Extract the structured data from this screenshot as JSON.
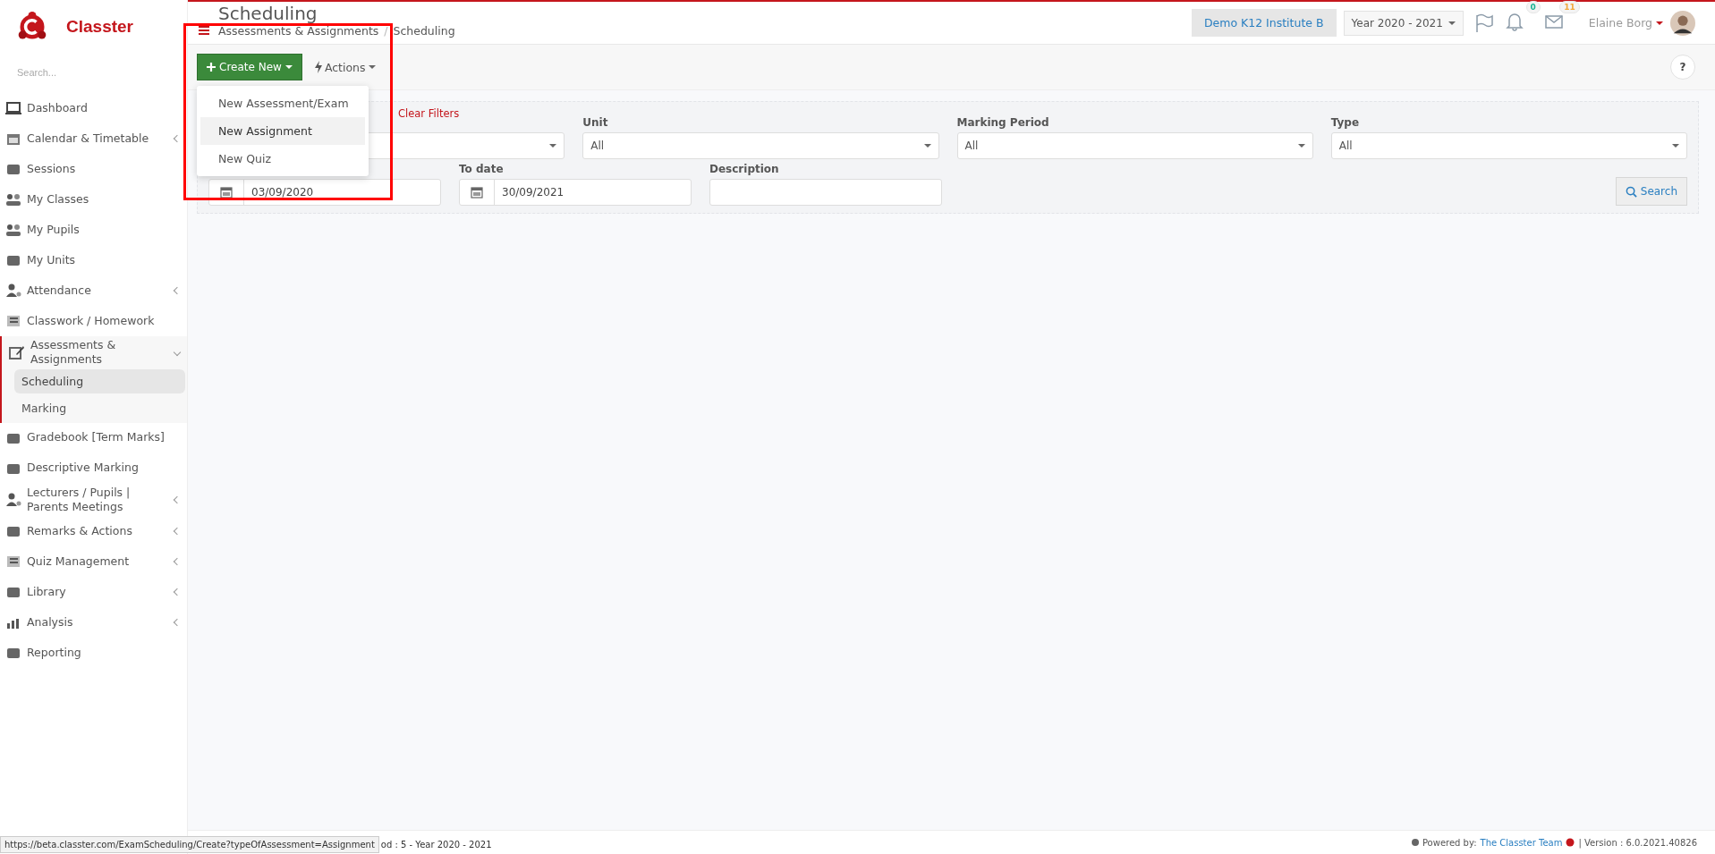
{
  "app": {
    "name": "Classter"
  },
  "sidebar": {
    "search": {
      "placeholder": "Search..."
    },
    "items": [
      {
        "label": "Dashboard",
        "has_submenu": false,
        "selected": false
      },
      {
        "label": "Calendar & Timetable",
        "has_submenu": true,
        "expanded": false,
        "selected": false
      },
      {
        "label": "Sessions",
        "has_submenu": false,
        "selected": false
      },
      {
        "label": "My Classes",
        "has_submenu": false,
        "selected": false
      },
      {
        "label": "My Pupils",
        "has_submenu": false,
        "selected": false
      },
      {
        "label": "My Units",
        "has_submenu": false,
        "selected": false
      },
      {
        "label": "Attendance",
        "has_submenu": true,
        "expanded": false,
        "selected": false
      },
      {
        "label": "Classwork / Homework",
        "has_submenu": false,
        "selected": false
      },
      {
        "label": "Assessments & Assignments",
        "has_submenu": true,
        "expanded": true,
        "selected": true,
        "children": [
          {
            "label": "Scheduling",
            "selected": true
          },
          {
            "label": "Marking",
            "selected": false
          }
        ]
      },
      {
        "label": "Gradebook [Term Marks]",
        "has_submenu": false,
        "selected": false
      },
      {
        "label": "Descriptive Marking",
        "has_submenu": false,
        "selected": false
      },
      {
        "label": "Lecturers / Pupils | Parents Meetings",
        "has_submenu": true,
        "expanded": false,
        "selected": false
      },
      {
        "label": "Remarks & Actions",
        "has_submenu": true,
        "expanded": false,
        "selected": false
      },
      {
        "label": "Quiz Management",
        "has_submenu": true,
        "expanded": false,
        "selected": false
      },
      {
        "label": "Library",
        "has_submenu": true,
        "expanded": false,
        "selected": false
      },
      {
        "label": "Analysis",
        "has_submenu": true,
        "expanded": false,
        "selected": false
      },
      {
        "label": "Reporting",
        "has_submenu": false,
        "selected": false
      }
    ]
  },
  "header": {
    "title": "Scheduling",
    "breadcrumb": [
      "Assessments & Assignments",
      "Scheduling"
    ],
    "breadcrumb_separator": "/",
    "institute": "Demo K12 Institute B",
    "year": "Year 2020 - 2021",
    "notifications_badge": "0",
    "messages_badge": "11",
    "user": "Elaine Borg"
  },
  "toolbar": {
    "create_button": "Create New",
    "actions_button": "Actions",
    "help": "?",
    "create_menu": [
      {
        "label": "New Assessment/Exam",
        "selected": false
      },
      {
        "label": "New Assignment",
        "selected": true
      },
      {
        "label": "New Quiz",
        "selected": false
      }
    ]
  },
  "filters": {
    "clear_link": "Clear Filters",
    "row_1": [
      {
        "kind": "select"
      },
      {
        "kind": "select",
        "label": "Unit",
        "value": "All"
      },
      {
        "kind": "select",
        "label": "Marking Period",
        "value": "All"
      },
      {
        "kind": "select",
        "label": "Type",
        "value": "All"
      }
    ],
    "row_2": [
      {
        "kind": "date",
        "value": "03/09/2020"
      },
      {
        "kind": "date",
        "label": "To date",
        "value": "30/09/2021"
      },
      {
        "kind": "text",
        "label": "Description"
      }
    ],
    "search_button": "Search"
  },
  "status_url": "https://beta.classter.com/ExamScheduling/Create?typeOfAssessment=Assignment",
  "footer": {
    "period": "od : 5 - Year 2020 - 2021",
    "powered_label": "Powered by:",
    "powered_link": "The Classter Team",
    "version": "| Version : 6.0.2021.40826"
  }
}
